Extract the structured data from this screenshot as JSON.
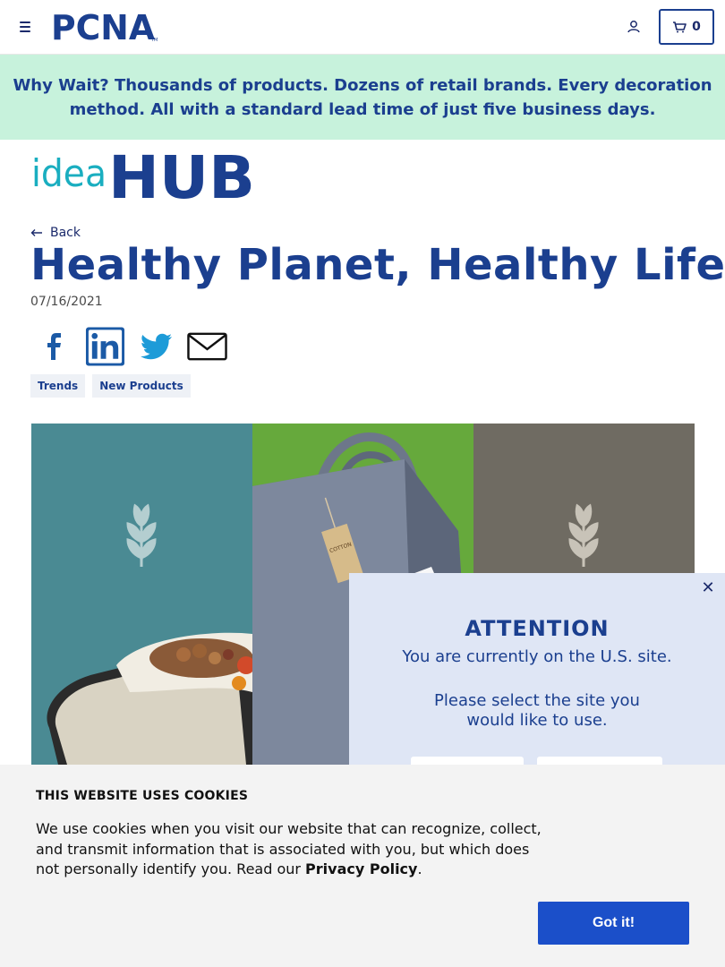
{
  "header": {
    "logo_text": "PCNA",
    "cart_count": "0"
  },
  "promo": {
    "lead": "Why Wait?",
    "text": "Thousands of products. Dozens of retail brands. Every decoration method. All with a standard lead time of just five business days."
  },
  "brand": {
    "idea": "idea",
    "hub": "HUB",
    "idea_color": "#1aaec0",
    "hub_color": "#1b3f8f"
  },
  "article": {
    "back_label": "Back",
    "title": "Healthy Planet, Healthy Life",
    "date": "07/16/2021",
    "share": [
      "facebook-icon",
      "linkedin-icon",
      "twitter-icon",
      "email-icon"
    ],
    "tags": [
      "Trends",
      "New Products"
    ]
  },
  "hero": {
    "panel_colors": [
      "#4a8a93",
      "#66a93c",
      "#6f6b62"
    ],
    "tote_tag_text": "COTTON"
  },
  "popup": {
    "title": "ATTENTION",
    "line1": "You are currently on the U.S. site.",
    "line2": "Please select the site you would like to use."
  },
  "cookie": {
    "title": "THIS WEBSITE USES COOKIES",
    "text": "We use cookies when you visit our website that can recognize, collect, and transmit information that is associated with you, but which does not personally identify you. Read our ",
    "link": "Privacy Policy",
    "after_link": ".",
    "button": "Got it!"
  }
}
